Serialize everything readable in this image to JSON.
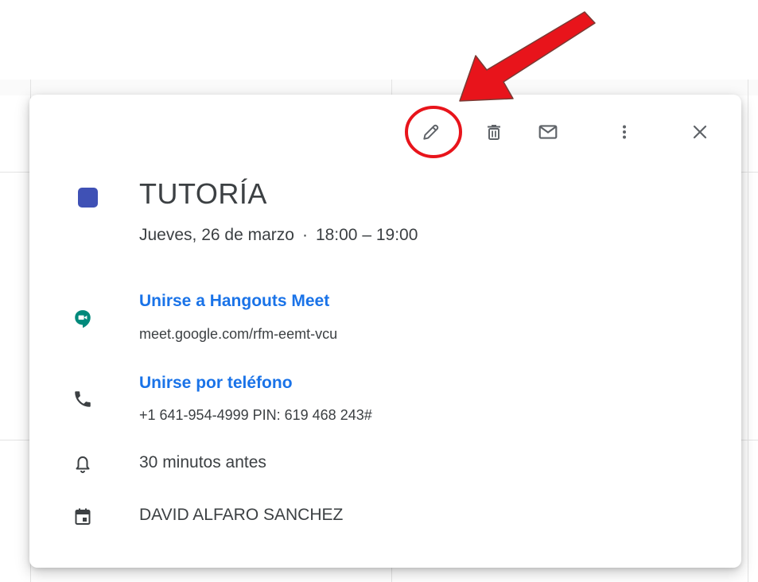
{
  "toolbar": {
    "edit_icon": "pencil-icon",
    "delete_icon": "trash-icon",
    "email_icon": "envelope-icon",
    "more_icon": "more-vert-icon",
    "close_icon": "close-icon"
  },
  "event": {
    "color": "#3f51b5",
    "title": "TUTORÍA",
    "date": "Jueves, 26 de marzo",
    "separator": "·",
    "time": "18:00 – 19:00"
  },
  "meet": {
    "icon": "hangouts-meet-icon",
    "link_label": "Unirse a Hangouts Meet",
    "url": "meet.google.com/rfm-eemt-vcu"
  },
  "phone": {
    "icon": "phone-icon",
    "link_label": "Unirse por teléfono",
    "details": "+1 641-954-4999 PIN: 619 468 243#"
  },
  "reminder": {
    "icon": "bell-icon",
    "text": "30 minutos antes"
  },
  "calendar": {
    "icon": "calendar-icon",
    "owner": "DAVID ALFARO SANCHEZ"
  },
  "annotation": {
    "arrow_color": "#e8141b",
    "circle_color": "#e8141b"
  }
}
